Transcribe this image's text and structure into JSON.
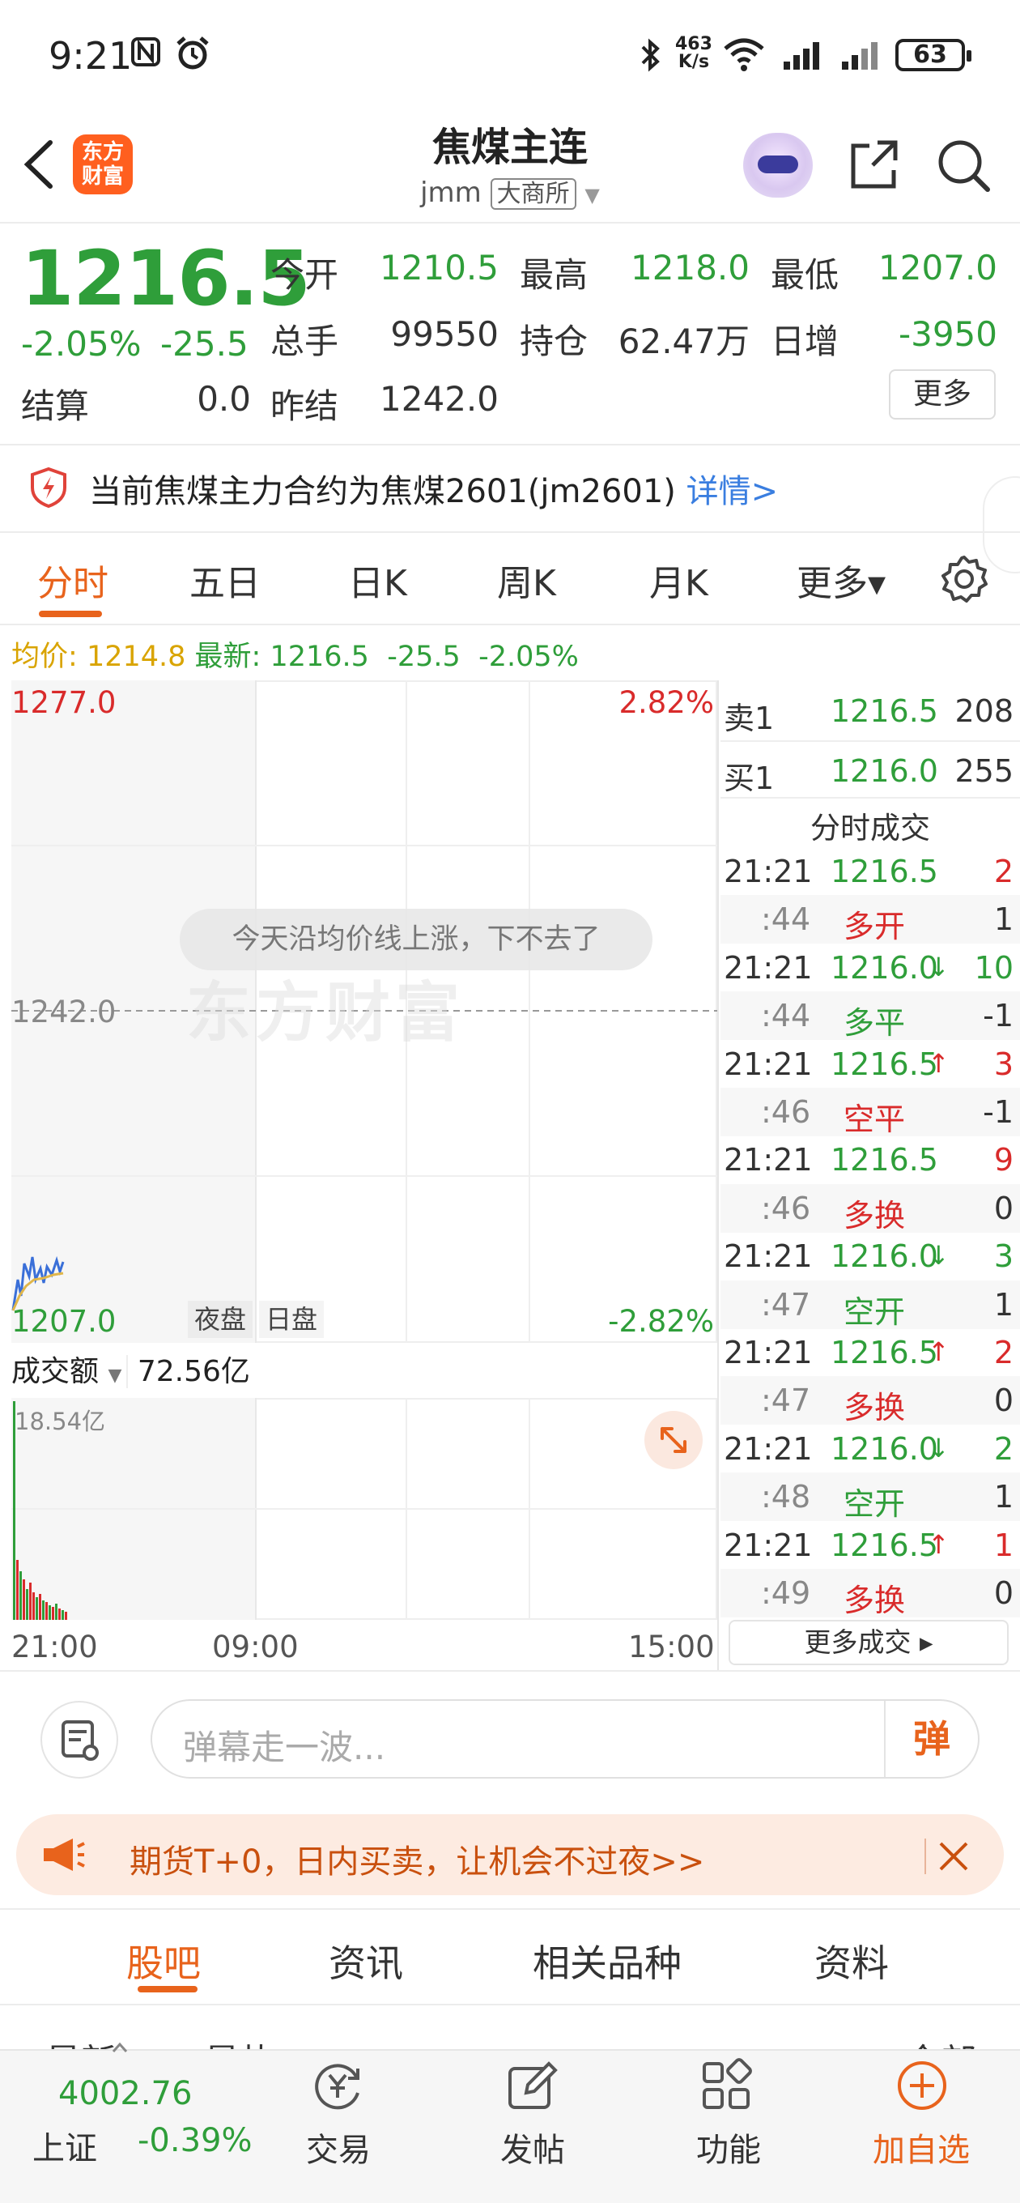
{
  "status_bar": {
    "time": "9:21",
    "net_speed_top": "463",
    "net_speed_unit": "K/s",
    "battery": "63"
  },
  "header": {
    "logo_line1": "东方",
    "logo_line2": "财富",
    "title": "焦煤主连",
    "code": "jmm",
    "exchange": "大商所"
  },
  "quote": {
    "price": "1216.5",
    "change_pct": "-2.05%",
    "change": "-25.5",
    "open_label": "今开",
    "open": "1210.5",
    "high_label": "最高",
    "high": "1218.0",
    "low_label": "最低",
    "low": "1207.0",
    "volume_label": "总手",
    "volume": "99550",
    "oi_label": "持仓",
    "oi": "62.47万",
    "daily_inc_label": "日增",
    "daily_inc": "-3950",
    "settle_label": "结算",
    "settle": "0.0",
    "prev_settle_label": "昨结",
    "prev_settle": "1242.0",
    "more": "更多"
  },
  "notice": {
    "text": "当前焦煤主力合约为焦煤2601(jm2601)",
    "link": "详情>"
  },
  "tabs": [
    "分时",
    "五日",
    "日K",
    "周K",
    "月K",
    "更多▾"
  ],
  "legend": {
    "avg_label": "均价:",
    "avg": "1214.8",
    "latest_label": "最新:",
    "latest": "1216.5",
    "latest_chg": "-25.5",
    "latest_pct": "-2.05%"
  },
  "chart": {
    "y_top": "1277.0",
    "y_mid": "1242.0",
    "y_bottom": "1207.0",
    "pct_top": "2.82%",
    "pct_bottom": "-2.82%",
    "bubble": "今天沿均价线上涨，下不去了",
    "watermark": "东方财富",
    "session_night": "夜盘",
    "session_day": "日盘",
    "vol_selector": "成交额",
    "vol_value": "72.56亿",
    "vol_max": "18.54亿",
    "time_start": "21:00",
    "time_mid": "09:00",
    "time_end": "15:00",
    "colors": {
      "price_line": "#3a6fd8",
      "avg_line": "#e0b64a",
      "vol_up": "#d92b2b",
      "vol_down": "#2f9e3a"
    }
  },
  "order_book": {
    "ask_label": "卖1",
    "ask_price": "1216.5",
    "ask_vol": "208",
    "bid_label": "买1",
    "bid_price": "1216.0",
    "bid_vol": "255",
    "ticks_title": "分时成交",
    "ticks": [
      {
        "time": "21:21",
        "price": "1216.5",
        "arrow": "",
        "vol": "2",
        "vol_dir": "up"
      },
      {
        "time": ":44",
        "price": "多开",
        "arrow": "",
        "vol": "1",
        "kind": "up"
      },
      {
        "time": "21:21",
        "price": "1216.0",
        "arrow": "↓",
        "vol": "10",
        "vol_dir": "down"
      },
      {
        "time": ":44",
        "price": "多平",
        "arrow": "",
        "vol": "-1",
        "kind": "down"
      },
      {
        "time": "21:21",
        "price": "1216.5",
        "arrow": "↑",
        "vol": "3",
        "vol_dir": "up"
      },
      {
        "time": ":46",
        "price": "空平",
        "arrow": "",
        "vol": "-1",
        "kind": "up"
      },
      {
        "time": "21:21",
        "price": "1216.5",
        "arrow": "",
        "vol": "9",
        "vol_dir": "up"
      },
      {
        "time": ":46",
        "price": "多换",
        "arrow": "",
        "vol": "0",
        "kind": "up"
      },
      {
        "time": "21:21",
        "price": "1216.0",
        "arrow": "↓",
        "vol": "3",
        "vol_dir": "down"
      },
      {
        "time": ":47",
        "price": "空开",
        "arrow": "",
        "vol": "1",
        "kind": "down"
      },
      {
        "time": "21:21",
        "price": "1216.5",
        "arrow": "↑",
        "vol": "2",
        "vol_dir": "up"
      },
      {
        "time": ":47",
        "price": "多换",
        "arrow": "",
        "vol": "0",
        "kind": "up"
      },
      {
        "time": "21:21",
        "price": "1216.0",
        "arrow": "↓",
        "vol": "2",
        "vol_dir": "down"
      },
      {
        "time": ":48",
        "price": "空开",
        "arrow": "",
        "vol": "1",
        "kind": "down"
      },
      {
        "time": "21:21",
        "price": "1216.5",
        "arrow": "↑",
        "vol": "1",
        "vol_dir": "up"
      },
      {
        "time": ":49",
        "price": "多换",
        "arrow": "",
        "vol": "0",
        "kind": "up"
      }
    ],
    "more_trades": "更多成交 ▸"
  },
  "comment": {
    "placeholder": "弹幕走一波...",
    "danmu_label": "弹"
  },
  "promo": {
    "text": "期货T+0，日内买卖，让机会不过夜>>"
  },
  "bottom_tabs": [
    "股吧",
    "资讯",
    "相关品种",
    "资料"
  ],
  "sub_tabs": {
    "left1": "最新",
    "left2": "最热",
    "right": "全部"
  },
  "nav": {
    "index_value": "4002.76",
    "index_name": "上证",
    "index_pct": "-0.39%",
    "trade": "交易",
    "post": "发帖",
    "function": "功能",
    "add_watch": "加自选"
  }
}
